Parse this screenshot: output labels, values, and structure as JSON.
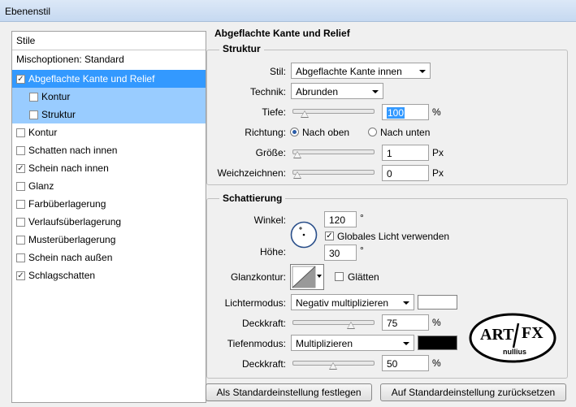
{
  "window": {
    "title": "Ebenenstil"
  },
  "left_panel": {
    "header": "Stile",
    "blending": "Mischoptionen: Standard",
    "items": [
      {
        "label": "Abgeflachte Kante und Relief",
        "checked": true,
        "state": "selected"
      },
      {
        "label": "Kontur",
        "checked": false,
        "state": "sub"
      },
      {
        "label": "Struktur",
        "checked": false,
        "state": "sub"
      },
      {
        "label": "Kontur",
        "checked": false
      },
      {
        "label": "Schatten nach innen",
        "checked": false
      },
      {
        "label": "Schein nach innen",
        "checked": true
      },
      {
        "label": "Glanz",
        "checked": false
      },
      {
        "label": "Farbüberlagerung",
        "checked": false
      },
      {
        "label": "Verlaufsüberlagerung",
        "checked": false
      },
      {
        "label": "Musterüberlagerung",
        "checked": false
      },
      {
        "label": "Schein nach außen",
        "checked": false
      },
      {
        "label": "Schlagschatten",
        "checked": true
      }
    ]
  },
  "bevel": {
    "title": "Abgeflachte Kante und Relief",
    "structure": {
      "title": "Struktur",
      "style_label": "Stil:",
      "style_value": "Abgeflachte Kante innen",
      "technique_label": "Technik:",
      "technique_value": "Abrunden",
      "depth_label": "Tiefe:",
      "depth_value": "100",
      "depth_unit": "%",
      "depth_level": 0.1,
      "direction_label": "Richtung:",
      "direction_up": "Nach oben",
      "direction_down": "Nach unten",
      "direction_selected": "Nach oben",
      "size_label": "Größe:",
      "size_value": "1",
      "size_unit": "Px",
      "size_level": 0.0,
      "soften_label": "Weichzeichnen:",
      "soften_value": "0",
      "soften_unit": "Px",
      "soften_level": 0.0
    },
    "shading": {
      "title": "Schattierung",
      "angle_label": "Winkel:",
      "angle_value": "120",
      "angle_unit": "°",
      "global_light_label": "Globales Licht verwenden",
      "global_light_checked": true,
      "altitude_label": "Höhe:",
      "altitude_value": "30",
      "altitude_unit": "°",
      "gloss_label": "Glanzkontur:",
      "antialias_label": "Glätten",
      "antialias_checked": false,
      "highlight_mode_label": "Lichtermodus:",
      "highlight_mode_value": "Negativ multiplizieren",
      "highlight_color": "#ffffff",
      "highlight_opacity_label": "Deckkraft:",
      "highlight_opacity_value": "75",
      "highlight_opacity_unit": "%",
      "highlight_opacity_level": 0.75,
      "shadow_mode_label": "Tiefenmodus:",
      "shadow_mode_value": "Multiplizieren",
      "shadow_color": "#000000",
      "shadow_opacity_label": "Deckkraft:",
      "shadow_opacity_value": "50",
      "shadow_opacity_unit": "%",
      "shadow_opacity_level": 0.5
    }
  },
  "buttons": {
    "make_default": "Als Standardeinstellung festlegen",
    "reset_default": "Auf Standardeinstellung zurücksetzen"
  },
  "logo": {
    "line1": "ART",
    "line2": "FX",
    "line3": "nullius"
  },
  "colors": {
    "selected": "#3399ff",
    "sub_selected": "#99ccff"
  }
}
